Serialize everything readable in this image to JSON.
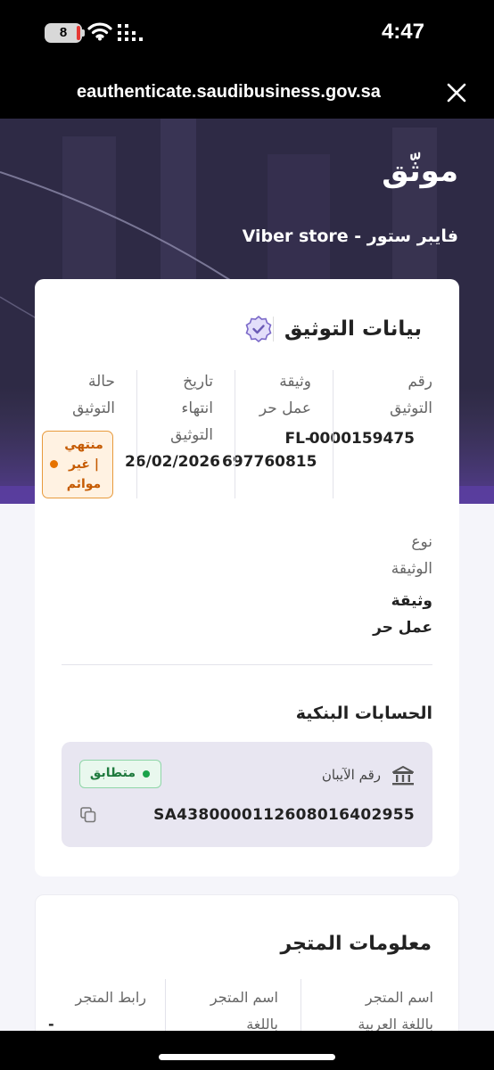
{
  "status_bar": {
    "time": "4:47",
    "battery": "8"
  },
  "browser": {
    "url": "eauthenticate.saudibusiness.gov.sa"
  },
  "hero": {
    "title": "موثّق",
    "subtitle": "فايبر ستور - Viber store"
  },
  "auth_card": {
    "title": "بيانات التوثيق",
    "columns": [
      {
        "label_line1": "رقم",
        "label_line2": "التوثيق",
        "value": "0000159475"
      },
      {
        "label_line1": "وثيقة",
        "label_line2": "عمل حر",
        "value_line1": "FL-",
        "value_line2": "697760815"
      },
      {
        "label_line1": "تاريخ",
        "label_line2": "انتهاء",
        "label_line3": "التوثيق",
        "value": "26/02/2026"
      },
      {
        "label_line1": "حالة",
        "label_line2": "التوثيق",
        "badge_line1": "منتهي",
        "badge_line2": "| غير",
        "badge_line3": "موائم"
      }
    ],
    "doc_type": {
      "label_line1": "نوع",
      "label_line2": "الوثيقة",
      "value_line1": "وثيقة",
      "value_line2": "عمل حر"
    },
    "bank_section_title": "الحسابات البنكية",
    "bank": {
      "iban_label": "رقم الآيبان",
      "status": "متطابق",
      "iban": "SA4380000112608016402955"
    }
  },
  "store_card": {
    "title": "معلومات المتجر",
    "columns": [
      {
        "line1": "اسم المتجر",
        "line2": "باللغة العربية"
      },
      {
        "line1": "اسم المتجر",
        "line2": "باللغة"
      },
      {
        "line1": "رابط المتجر",
        "line2": "-"
      }
    ]
  },
  "colors": {
    "hero_bg": "#2b2740",
    "accent_purple": "#6b5bb5",
    "expired_orange": "#e67300",
    "match_green": "#1aa34a"
  }
}
